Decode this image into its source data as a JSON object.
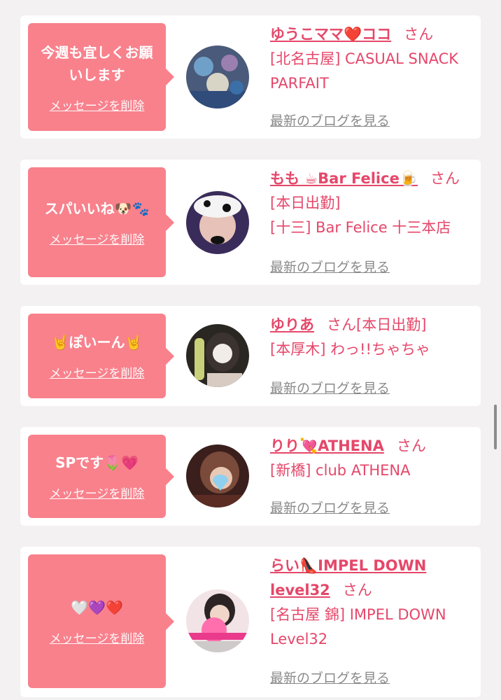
{
  "cards": [
    {
      "bubble_message": "今週も宜しくお願いします",
      "delete_label": "メッセージを削除",
      "name": "ゆうこママ❤️ココ",
      "honorific": "さん",
      "status": "",
      "shop": "[北名古屋] CASUAL SNACK PARFAIT",
      "blog_label": "最新のブログを見る"
    },
    {
      "bubble_message": "スパいいね🐶🐾",
      "delete_label": "メッセージを削除",
      "name": "もも ☕Bar Felice🍺",
      "honorific": "さん",
      "status": "[本日出勤]",
      "shop": "[十三] Bar Felice 十三本店",
      "blog_label": "最新のブログを見る"
    },
    {
      "bubble_message": "🤘ぽいーん🤘",
      "delete_label": "メッセージを削除",
      "name": "ゆりあ",
      "honorific": "さん",
      "status": "[本日出勤]",
      "shop": "[本厚木] わっ!!ちゃちゃ",
      "blog_label": "最新のブログを見る"
    },
    {
      "bubble_message": "SPです🌷💗",
      "delete_label": "メッセージを削除",
      "name": "りり💘ATHENA",
      "honorific": "さん",
      "status": "",
      "shop": "[新橋] club ATHENA",
      "blog_label": "最新のブログを見る"
    },
    {
      "bubble_message": "🤍💜❤️",
      "delete_label": "メッセージを削除",
      "name": "らい👠IMPEL DOWN level32",
      "honorific": "さん",
      "status": "",
      "shop": "[名古屋 錦] IMPEL DOWN Level32",
      "blog_label": "最新のブログを見る"
    }
  ],
  "colors": {
    "bubble": "#f8818c",
    "accent_text": "#e5476a",
    "muted_link": "#8a8a8a",
    "background": "#f3f1f2"
  }
}
